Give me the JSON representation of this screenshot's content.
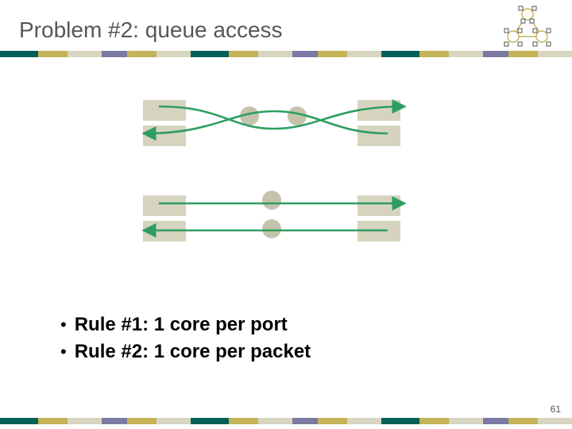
{
  "title": "Problem #2: queue access",
  "bullets": {
    "items": [
      {
        "text": "Rule #1: 1 core per port"
      },
      {
        "text": "Rule #2: 1 core per packet"
      }
    ]
  },
  "page_number": "61",
  "stripe_colors": [
    "#026057",
    "#c5b358",
    "#d8d5c0",
    "#7a7aa3",
    "#c5b358",
    "#d8d5c0",
    "#026057",
    "#c5b358",
    "#d8d5c0",
    "#7a7aa3",
    "#c5b358",
    "#d8d5c0",
    "#026057",
    "#c5b358",
    "#d8d5c0",
    "#7a7aa3",
    "#c5b358",
    "#d8d5c0"
  ],
  "diagram": {
    "arrow_color": "#2e9e60"
  }
}
